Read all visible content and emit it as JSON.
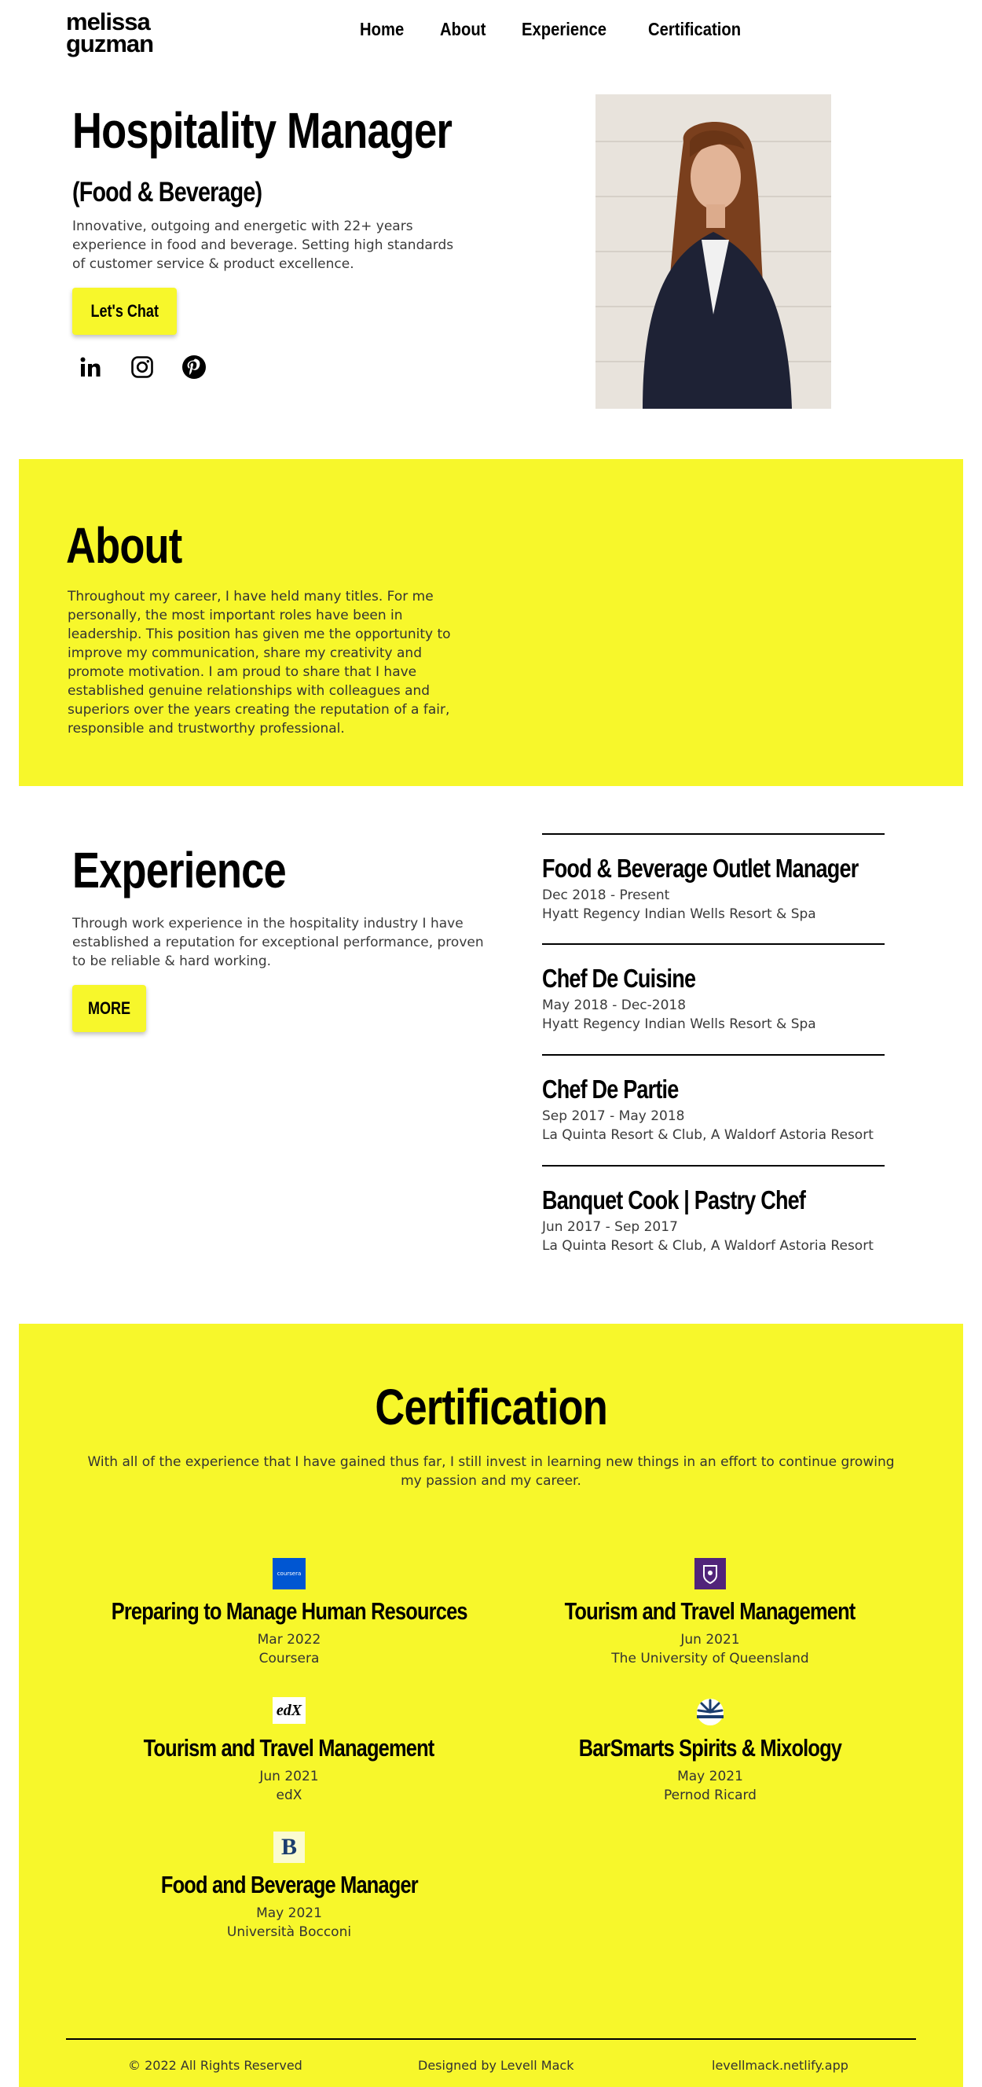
{
  "brand": {
    "line1": "melissa",
    "line2": "guzman"
  },
  "nav": [
    {
      "label": "Home"
    },
    {
      "label": "About"
    },
    {
      "label": "Experience"
    },
    {
      "label": "Certification"
    }
  ],
  "hero": {
    "title": "Hospitality Manager",
    "subtitle": "(Food & Beverage)",
    "description": "Innovative, outgoing and energetic with 22+ years experience in food and beverage. Setting high standards of customer service & product excellence.",
    "cta_label": "Let's Chat",
    "socials": [
      {
        "icon": "linkedin-icon"
      },
      {
        "icon": "instagram-icon"
      },
      {
        "icon": "pinterest-icon"
      }
    ],
    "photo": "portrait-photo"
  },
  "about": {
    "title": "About",
    "text": "Throughout my career, I have held many titles. For me personally, the most important roles have been in leadership. This position has given me the opportunity to improve my communication, share my creativity and promote motivation. I am proud to share that I have established genuine relationships with colleagues and superiors over the years creating the reputation of a fair, responsible and trustworthy professional."
  },
  "experience": {
    "title": "Experience",
    "description": "Through work experience in the hospitality industry I have established a reputation for exceptional performance, proven to be reliable & hard working.",
    "more_label": "MORE",
    "jobs": [
      {
        "title": "Food & Beverage Outlet Manager",
        "dates": "Dec 2018 - Present",
        "place": "Hyatt Regency Indian Wells Resort & Spa"
      },
      {
        "title": "Chef De Cuisine",
        "dates": "May 2018 - Dec-2018",
        "place": "Hyatt Regency Indian Wells Resort & Spa"
      },
      {
        "title": "Chef De Partie",
        "dates": "Sep 2017 - May 2018",
        "place": "La Quinta Resort & Club, A Waldorf Astoria Resort"
      },
      {
        "title": "Banquet Cook | Pastry Chef",
        "dates": "Jun 2017 - Sep 2017",
        "place": "La Quinta Resort & Club, A Waldorf Astoria Resort"
      }
    ]
  },
  "certification": {
    "title": "Certification",
    "intro": "With all of the experience that I have gained thus far, I still invest in learning new things in an effort to continue growing my passion and my career.",
    "items": [
      {
        "name": "Preparing to Manage Human Resources",
        "date": "Mar 2022",
        "issuer": "Coursera",
        "logo_text": "coursera"
      },
      {
        "name": "Tourism and Travel Management",
        "date": "Jun 2021",
        "issuer": "The University of Queensland",
        "logo_text": ""
      },
      {
        "name": "Tourism and Travel Management",
        "date": "Jun 2021",
        "issuer": "edX",
        "logo_text": "edX"
      },
      {
        "name": "BarSmarts Spirits & Mixology",
        "date": "May 2021",
        "issuer": "Pernod Ricard",
        "logo_text": ""
      },
      {
        "name": "Food and Beverage Manager",
        "date": "May 2021",
        "issuer": "Università Bocconi",
        "logo_text": "B"
      }
    ]
  },
  "footer": {
    "copyright": "© 2022 All Rights Reserved",
    "designer": "Designed by Levell Mack",
    "site": "levellmack.netlify.app"
  },
  "colors": {
    "accent": "#f7f72b",
    "text": "#000000",
    "coursera": "#0056d2",
    "uq": "#51247a"
  }
}
